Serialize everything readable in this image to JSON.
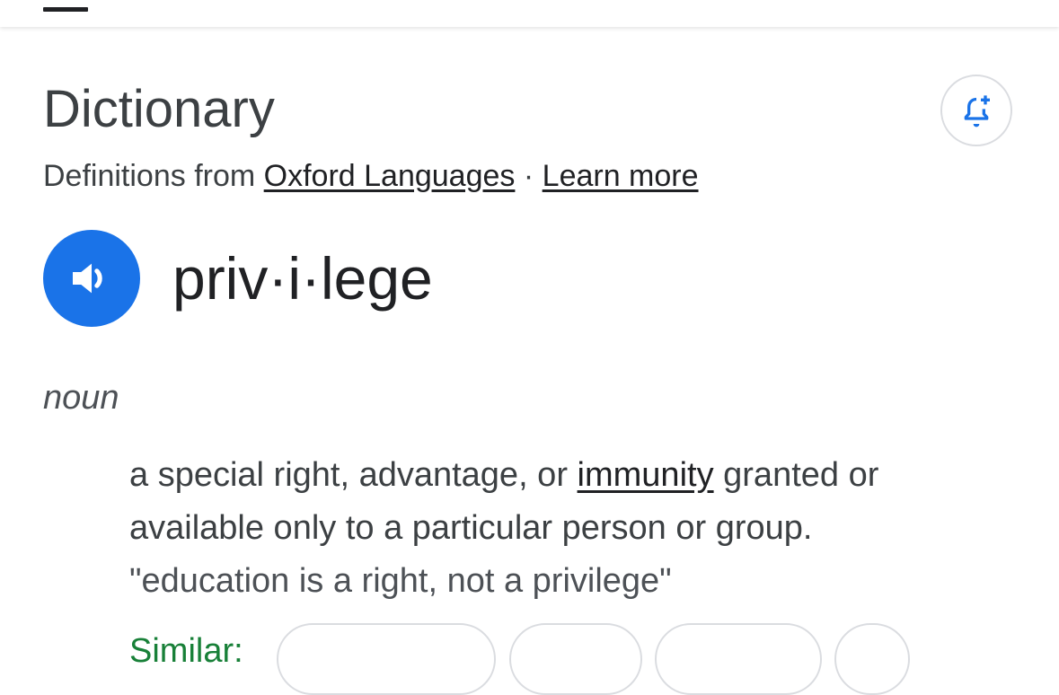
{
  "header": {
    "title": "Dictionary",
    "source_prefix": "Definitions from",
    "source_link": "Oxford Languages",
    "separator": "·",
    "learn_more": "Learn more"
  },
  "entry": {
    "headword": "priv·i·lege",
    "part_of_speech": "noun",
    "definition": {
      "before": "a special right, advantage, or",
      "link": "immunity",
      "after": "granted or available only to a particular person or group."
    },
    "example": "\"education is a right, not a privilege\"",
    "similar_label": "Similar:"
  },
  "icons": {
    "speaker": "volume-up-icon",
    "alert": "add-alert-icon"
  },
  "colors": {
    "accent": "#1a73e8",
    "similar_green": "#188038",
    "title": "#3c4043"
  }
}
